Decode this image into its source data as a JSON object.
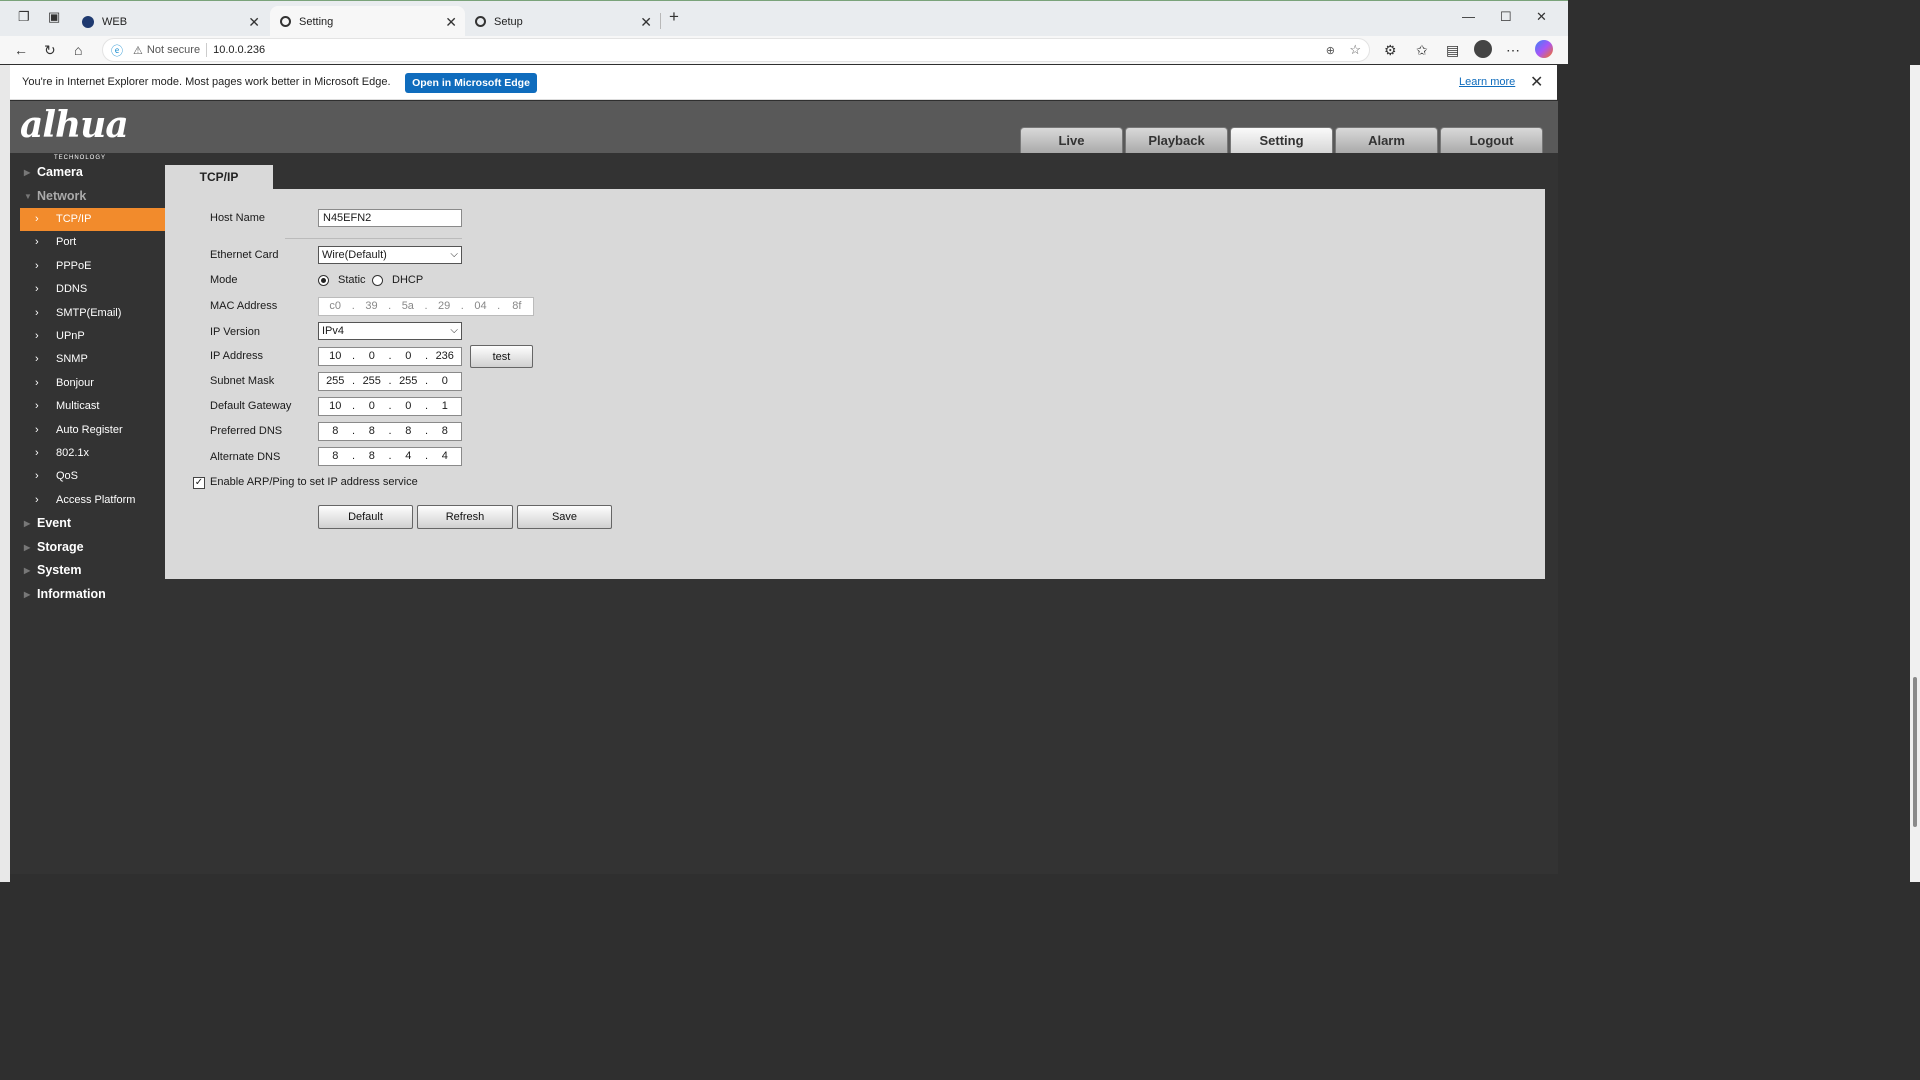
{
  "browser": {
    "tabs": [
      {
        "title": "WEB"
      },
      {
        "title": "Setting"
      },
      {
        "title": "Setup"
      }
    ],
    "security_label": "Not secure",
    "url": "10.0.0.236"
  },
  "ie_bar": {
    "message": "You're in Internet Explorer mode. Most pages work better in Microsoft Edge.",
    "open_edge": "Open in Microsoft Edge",
    "learn_more": "Learn more"
  },
  "app": {
    "logo": "alhua",
    "logo_sub": "TECHNOLOGY",
    "top_tabs": [
      "Live",
      "Playback",
      "Setting",
      "Alarm",
      "Logout"
    ],
    "sidebar": {
      "camera": "Camera",
      "network": "Network",
      "network_items": [
        "TCP/IP",
        "Port",
        "PPPoE",
        "DDNS",
        "SMTP(Email)",
        "UPnP",
        "SNMP",
        "Bonjour",
        "Multicast",
        "Auto Register",
        "802.1x",
        "QoS",
        "Access Platform"
      ],
      "event": "Event",
      "storage": "Storage",
      "system": "System",
      "information": "Information"
    },
    "content_tab": "TCP/IP",
    "form": {
      "host_name_label": "Host Name",
      "host_name": "N45EFN2",
      "ethernet_label": "Ethernet Card",
      "ethernet_value": "Wire(Default)",
      "mode_label": "Mode",
      "mode_static": "Static",
      "mode_dhcp": "DHCP",
      "mac_label": "MAC Address",
      "mac": [
        "c0",
        "39",
        "5a",
        "29",
        "04",
        "8f"
      ],
      "ipver_label": "IP Version",
      "ipver_value": "IPv4",
      "ip_label": "IP Address",
      "ip": [
        "10",
        "0",
        "0",
        "236"
      ],
      "test_button": "test",
      "subnet_label": "Subnet Mask",
      "subnet": [
        "255",
        "255",
        "255",
        "0"
      ],
      "gateway_label": "Default Gateway",
      "gateway": [
        "10",
        "0",
        "0",
        "1"
      ],
      "pdns_label": "Preferred DNS",
      "pdns": [
        "8",
        "8",
        "8",
        "8"
      ],
      "adns_label": "Alternate DNS",
      "adns": [
        "8",
        "8",
        "4",
        "4"
      ],
      "arp_label": "Enable ARP/Ping to set IP address service",
      "default_button": "Default",
      "refresh_button": "Refresh",
      "save_button": "Save"
    }
  }
}
